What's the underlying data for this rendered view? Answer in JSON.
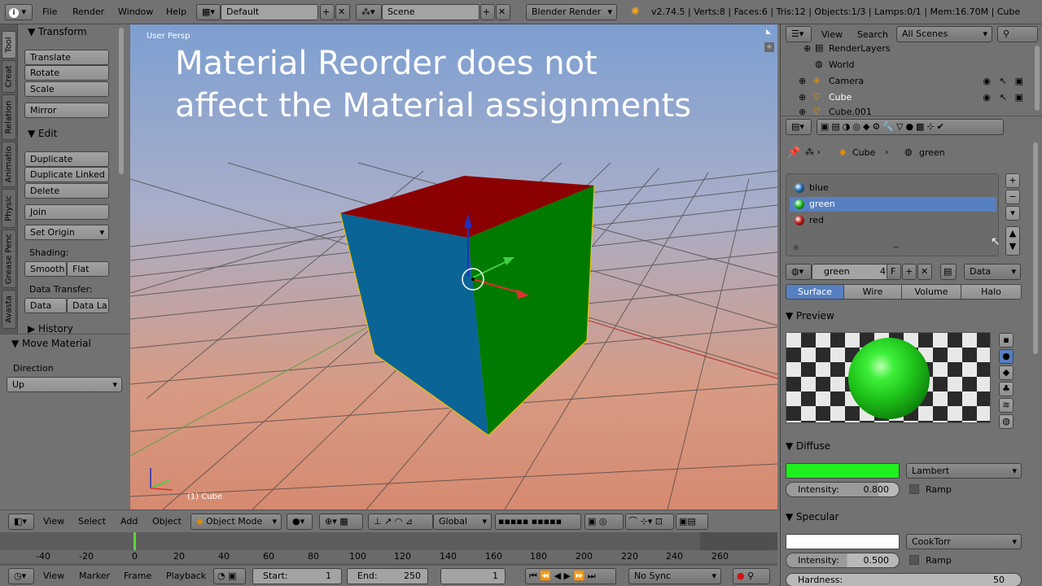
{
  "topbar": {
    "menus": [
      "File",
      "Render",
      "Window",
      "Help"
    ],
    "layout": "Default",
    "scene": "Scene",
    "engine": "Blender Render",
    "stats": "v2.74.5 | Verts:8 | Faces:6 | Tris:12 | Objects:1/3 | Lamps:0/1 | Mem:16.70M | Cube"
  },
  "tool_tabs": [
    "Tool",
    "Creat",
    "Relation",
    "Animatio",
    "Physic",
    "Grease Penc",
    "Avasta"
  ],
  "tool_panel": {
    "transform_title": "Transform",
    "translate": "Translate",
    "rotate": "Rotate",
    "scale": "Scale",
    "mirror": "Mirror",
    "edit_title": "Edit",
    "duplicate": "Duplicate",
    "duplicate_linked": "Duplicate Linked",
    "delete": "Delete",
    "join": "Join",
    "set_origin": "Set Origin",
    "shading_label": "Shading:",
    "smooth": "Smooth",
    "flat": "Flat",
    "data_transfer_label": "Data Transfer:",
    "data": "Data",
    "data_la": "Data La",
    "history": "History"
  },
  "move_material": {
    "title": "Move Material",
    "direction_label": "Direction",
    "direction_value": "Up"
  },
  "viewport": {
    "view_label": "User Persp",
    "overlay_line1": "Material Reorder does not",
    "overlay_line2": "affect the Material assignments",
    "object_label": "(1) Cube",
    "face_colors": {
      "top": "#8b0000",
      "left": "#0b6496",
      "right": "#007a00"
    }
  },
  "header3d": {
    "view": "View",
    "select": "Select",
    "add": "Add",
    "object": "Object",
    "mode": "Object Mode",
    "orientation": "Global"
  },
  "timeline": {
    "ticks": [
      "-40",
      "-20",
      "0",
      "20",
      "40",
      "60",
      "80",
      "100",
      "120",
      "140",
      "160",
      "180",
      "200",
      "220",
      "240",
      "260"
    ],
    "view": "View",
    "marker": "Marker",
    "frame": "Frame",
    "playback": "Playback",
    "start_label": "Start:",
    "start_value": "1",
    "end_label": "End:",
    "end_value": "250",
    "current": "1",
    "sync": "No Sync"
  },
  "outliner": {
    "view": "View",
    "search": "Search",
    "filter": "All Scenes",
    "items": [
      "RenderLayers",
      "World",
      "Camera",
      "Cube",
      "Cube.001"
    ]
  },
  "properties": {
    "breadcrumb_object": "Cube",
    "breadcrumb_material": "green",
    "materials": [
      {
        "name": "blue",
        "color": "#1f6fb8"
      },
      {
        "name": "green",
        "color": "#22c01e"
      },
      {
        "name": "red",
        "color": "#c01818"
      }
    ],
    "material_name": "green",
    "user_count": "4",
    "fake_user": "F",
    "link": "Data",
    "tabs": [
      "Surface",
      "Wire",
      "Volume",
      "Halo"
    ],
    "preview_title": "Preview",
    "diffuse_title": "Diffuse",
    "diffuse_color": "#1ef01e",
    "diffuse_shader": "Lambert",
    "diffuse_intensity_label": "Intensity:",
    "diffuse_intensity": "0.800",
    "ramp": "Ramp",
    "specular_title": "Specular",
    "specular_color": "#ffffff",
    "specular_shader": "CookTorr",
    "specular_intensity_label": "Intensity:",
    "specular_intensity": "0.500",
    "hardness_label": "Hardness:",
    "hardness_value": "50"
  }
}
